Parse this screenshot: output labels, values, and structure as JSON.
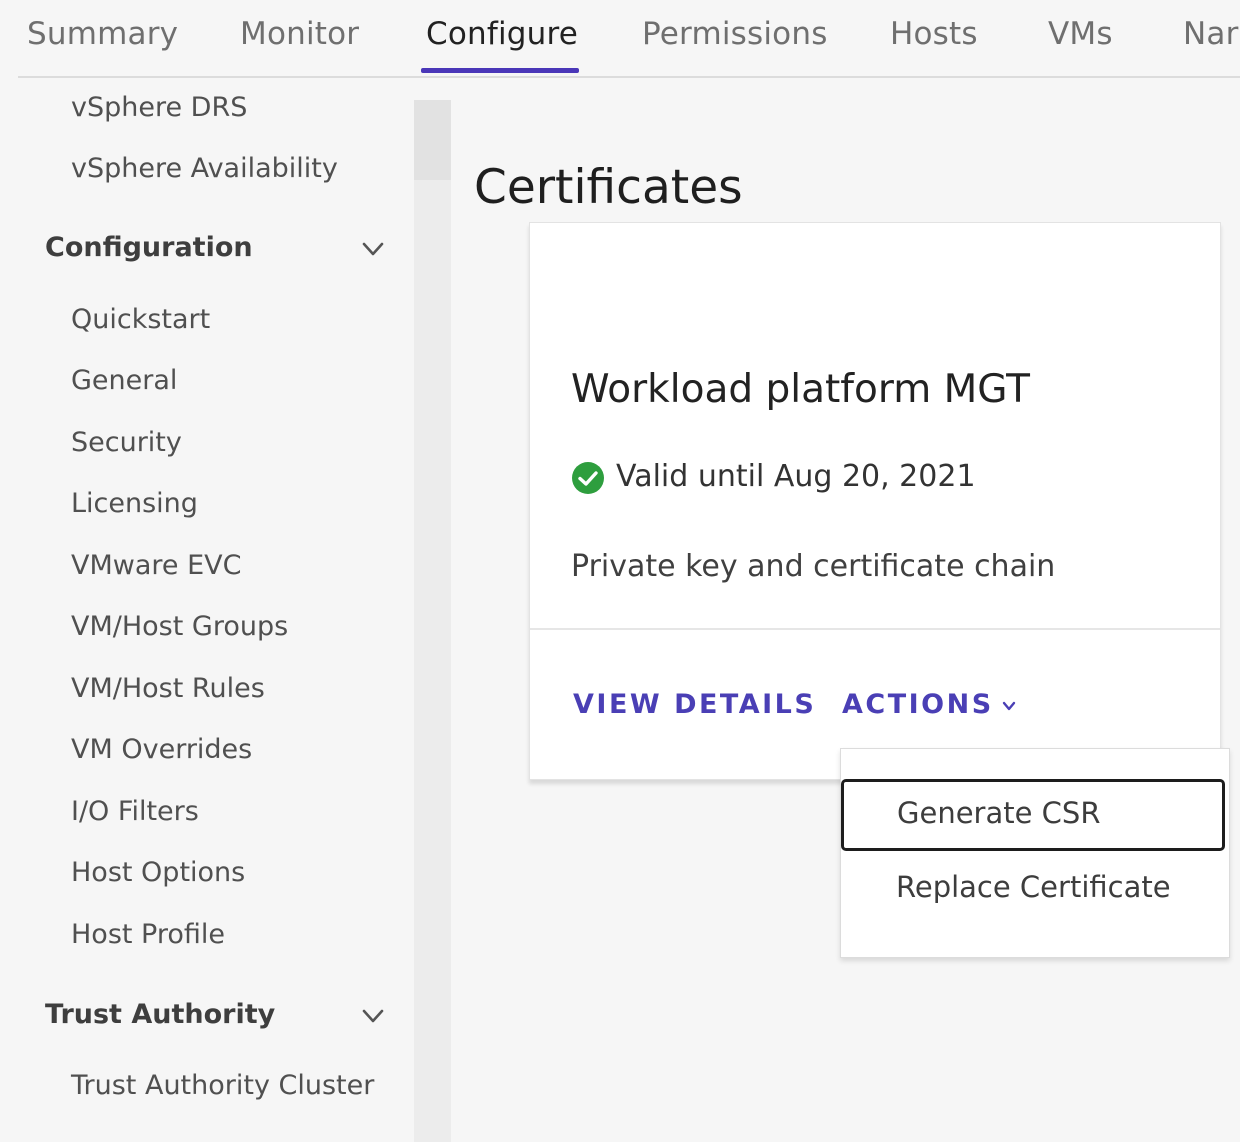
{
  "tabs": [
    {
      "label": "Summary",
      "active": false
    },
    {
      "label": "Monitor",
      "active": false
    },
    {
      "label": "Configure",
      "active": true
    },
    {
      "label": "Permissions",
      "active": false
    },
    {
      "label": "Hosts",
      "active": false
    },
    {
      "label": "VMs",
      "active": false
    },
    {
      "label": "Nar",
      "active": false
    }
  ],
  "sidebar": {
    "top_items": [
      "vSphere DRS",
      "vSphere Availability"
    ],
    "configuration": {
      "label": "Configuration",
      "items": [
        "Quickstart",
        "General",
        "Security",
        "Licensing",
        "VMware EVC",
        "VM/Host Groups",
        "VM/Host Rules",
        "VM Overrides",
        "I/O Filters",
        "Host Options",
        "Host Profile"
      ]
    },
    "trust_authority": {
      "label": "Trust Authority",
      "items": [
        "Trust Authority Cluster"
      ]
    }
  },
  "main": {
    "title": "Certificates",
    "card": {
      "title": "Workload platform MGT",
      "status": "Valid until Aug 20, 2021",
      "status_color": "#2e9e3e",
      "description": "Private key and certificate chain",
      "view_details": "VIEW DETAILS",
      "actions": "ACTIONS"
    },
    "actions_menu": {
      "items": [
        "Generate CSR",
        "Replace Certificate"
      ],
      "focused_index": 0
    }
  },
  "colors": {
    "accent": "#4a3fb5",
    "tab_underline": "#4a37b8",
    "success": "#2e9e3e"
  },
  "icons": {
    "chevron": "chevron-down-icon",
    "status": "check-circle-icon"
  }
}
